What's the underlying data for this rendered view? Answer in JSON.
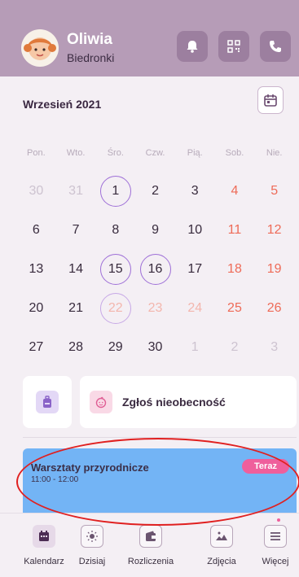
{
  "header": {
    "child_name": "Oliwia",
    "group_name": "Biedronki",
    "icons": [
      "bell-icon",
      "qr-code-icon",
      "phone-icon"
    ]
  },
  "calendar": {
    "month_title": "Wrzesień 2021",
    "weekdays": [
      "Pon.",
      "Wto.",
      "Śro.",
      "Czw.",
      "Pią.",
      "Sob.",
      "Nie."
    ],
    "weeks": [
      [
        {
          "d": "30",
          "outside": true
        },
        {
          "d": "31",
          "outside": true
        },
        {
          "d": "1",
          "ring": true
        },
        {
          "d": "2"
        },
        {
          "d": "3"
        },
        {
          "d": "4",
          "weekend": true
        },
        {
          "d": "5",
          "weekend": true
        }
      ],
      [
        {
          "d": "6"
        },
        {
          "d": "7"
        },
        {
          "d": "8"
        },
        {
          "d": "9"
        },
        {
          "d": "10"
        },
        {
          "d": "11",
          "weekend": true
        },
        {
          "d": "12",
          "weekend": true
        }
      ],
      [
        {
          "d": "13"
        },
        {
          "d": "14"
        },
        {
          "d": "15",
          "ring": true
        },
        {
          "d": "16",
          "ring": true
        },
        {
          "d": "17"
        },
        {
          "d": "18",
          "weekend": true
        },
        {
          "d": "19",
          "weekend": true
        }
      ],
      [
        {
          "d": "20"
        },
        {
          "d": "21"
        },
        {
          "d": "22",
          "ring": true,
          "today": true
        },
        {
          "d": "23",
          "weekend_light": true
        },
        {
          "d": "24",
          "weekend_light": true
        },
        {
          "d": "25",
          "weekend": true
        },
        {
          "d": "26",
          "weekend": true
        }
      ],
      [
        {
          "d": "27"
        },
        {
          "d": "28"
        },
        {
          "d": "29"
        },
        {
          "d": "30"
        },
        {
          "d": "1",
          "outside": true
        },
        {
          "d": "2",
          "outside": true
        },
        {
          "d": "3",
          "outside": true
        }
      ]
    ]
  },
  "quick_actions": {
    "absence_label": "Zgłoś nieobecność"
  },
  "event": {
    "title": "Warsztaty przyrodnicze",
    "time": "11:00 - 12:00",
    "badge": "Teraz",
    "color": "#73b4f5"
  },
  "bottom_nav": [
    {
      "label": "Kalendarz",
      "icon": "calendar-icon",
      "active": true
    },
    {
      "label": "Dzisiaj",
      "icon": "sun-icon"
    },
    {
      "label": "Rozliczenia",
      "icon": "wallet-icon"
    },
    {
      "label": "Zdjęcia",
      "icon": "image-icon"
    },
    {
      "label": "Więcej",
      "icon": "menu-icon"
    }
  ],
  "colors": {
    "header_bg": "#b69cb7",
    "accent_ring": "#9e6fd7",
    "weekend": "#ee6b58",
    "badge": "#ef5f9c",
    "annotation": "#e02020"
  }
}
